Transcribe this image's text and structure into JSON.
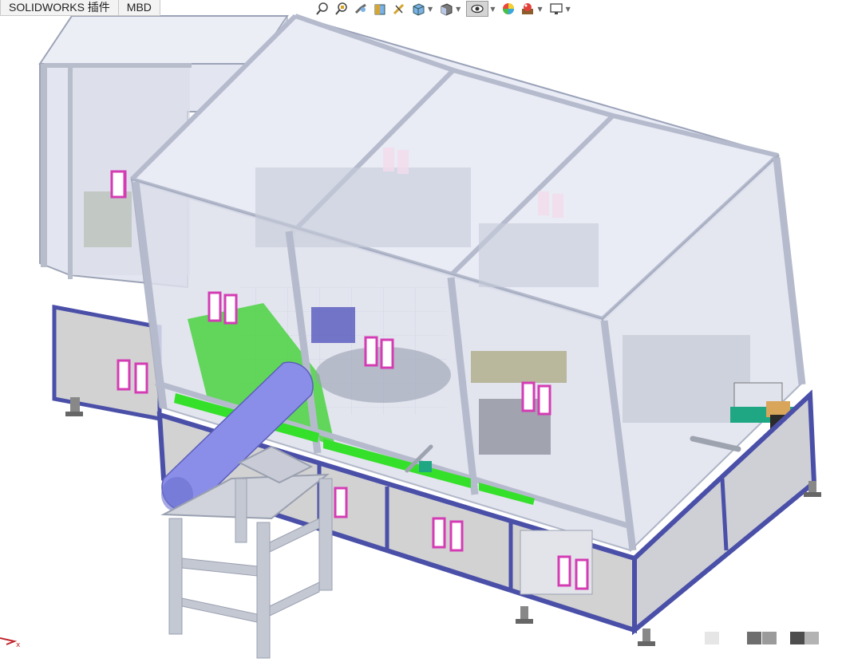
{
  "tabs": [
    {
      "label": "SOLIDWORKS 插件"
    },
    {
      "label": "MBD"
    }
  ],
  "heads_up_toolbar": [
    {
      "icon": "zoom-to-fit-icon",
      "dropdown": false
    },
    {
      "icon": "zoom-to-area-icon",
      "dropdown": false
    },
    {
      "icon": "previous-view-icon",
      "dropdown": false
    },
    {
      "icon": "section-view-icon",
      "dropdown": false
    },
    {
      "icon": "dynamic-annotation-icon",
      "dropdown": false
    },
    {
      "icon": "view-orientation-icon",
      "dropdown": true
    },
    {
      "icon": "display-style-icon",
      "dropdown": true
    },
    {
      "icon": "hide-show-items-icon",
      "dropdown": true
    },
    {
      "icon": "edit-appearance-icon",
      "dropdown": false
    },
    {
      "icon": "apply-scene-icon",
      "dropdown": true
    },
    {
      "icon": "view-settings-icon",
      "dropdown": true
    }
  ],
  "triad": {
    "axis_label": "x"
  },
  "colors": {
    "frame": "#c4c9d6",
    "glass": "#e6e9f5",
    "base_trim": "#4a4fa8",
    "panel": "#d2d2d2",
    "green_part": "#35d12a",
    "cylinder": "#8a8ee8",
    "handle": "#d43cb4"
  }
}
